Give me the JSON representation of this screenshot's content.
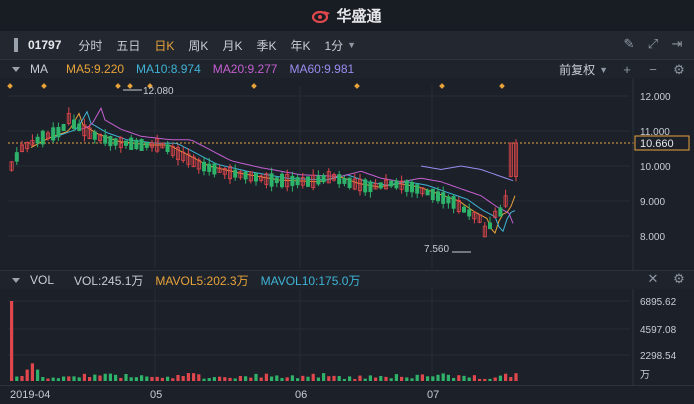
{
  "app": {
    "title": "华盛通"
  },
  "toolbar": {
    "code": "01797",
    "tabs": [
      "分时",
      "五日",
      "日K",
      "周K",
      "月K",
      "季K",
      "年K"
    ],
    "active_tab": "日K",
    "period_select": "1分"
  },
  "ma_bar": {
    "label": "MA",
    "ma5": "MA5:9.220",
    "ma10": "MA10:8.974",
    "ma20": "MA20:9.277",
    "ma60": "MA60:9.981",
    "adjust": "前复权"
  },
  "price_axis": {
    "ticks": [
      "12.000",
      "11.000",
      "10.000",
      "9.000",
      "8.000"
    ],
    "current": "10.660",
    "high_label": "12.080",
    "low_label": "7.560"
  },
  "vol_bar": {
    "label": "VOL",
    "vol": "VOL:245.1万",
    "mavol5": "MAVOL5:202.3万",
    "mavol10": "MAVOL10:175.0万"
  },
  "vol_axis": {
    "ticks": [
      "6895.62",
      "4597.08",
      "2298.54"
    ],
    "unit": "万"
  },
  "date_axis": [
    "2019-04",
    "05",
    "06",
    "07"
  ],
  "colors": {
    "up": "#e0474c",
    "down": "#2fb36b",
    "ma5": "#e8a33a",
    "ma10": "#3fb3d6",
    "ma20": "#c45fd1",
    "ma60": "#9a8cf0",
    "accent": "#e8a33a"
  }
}
